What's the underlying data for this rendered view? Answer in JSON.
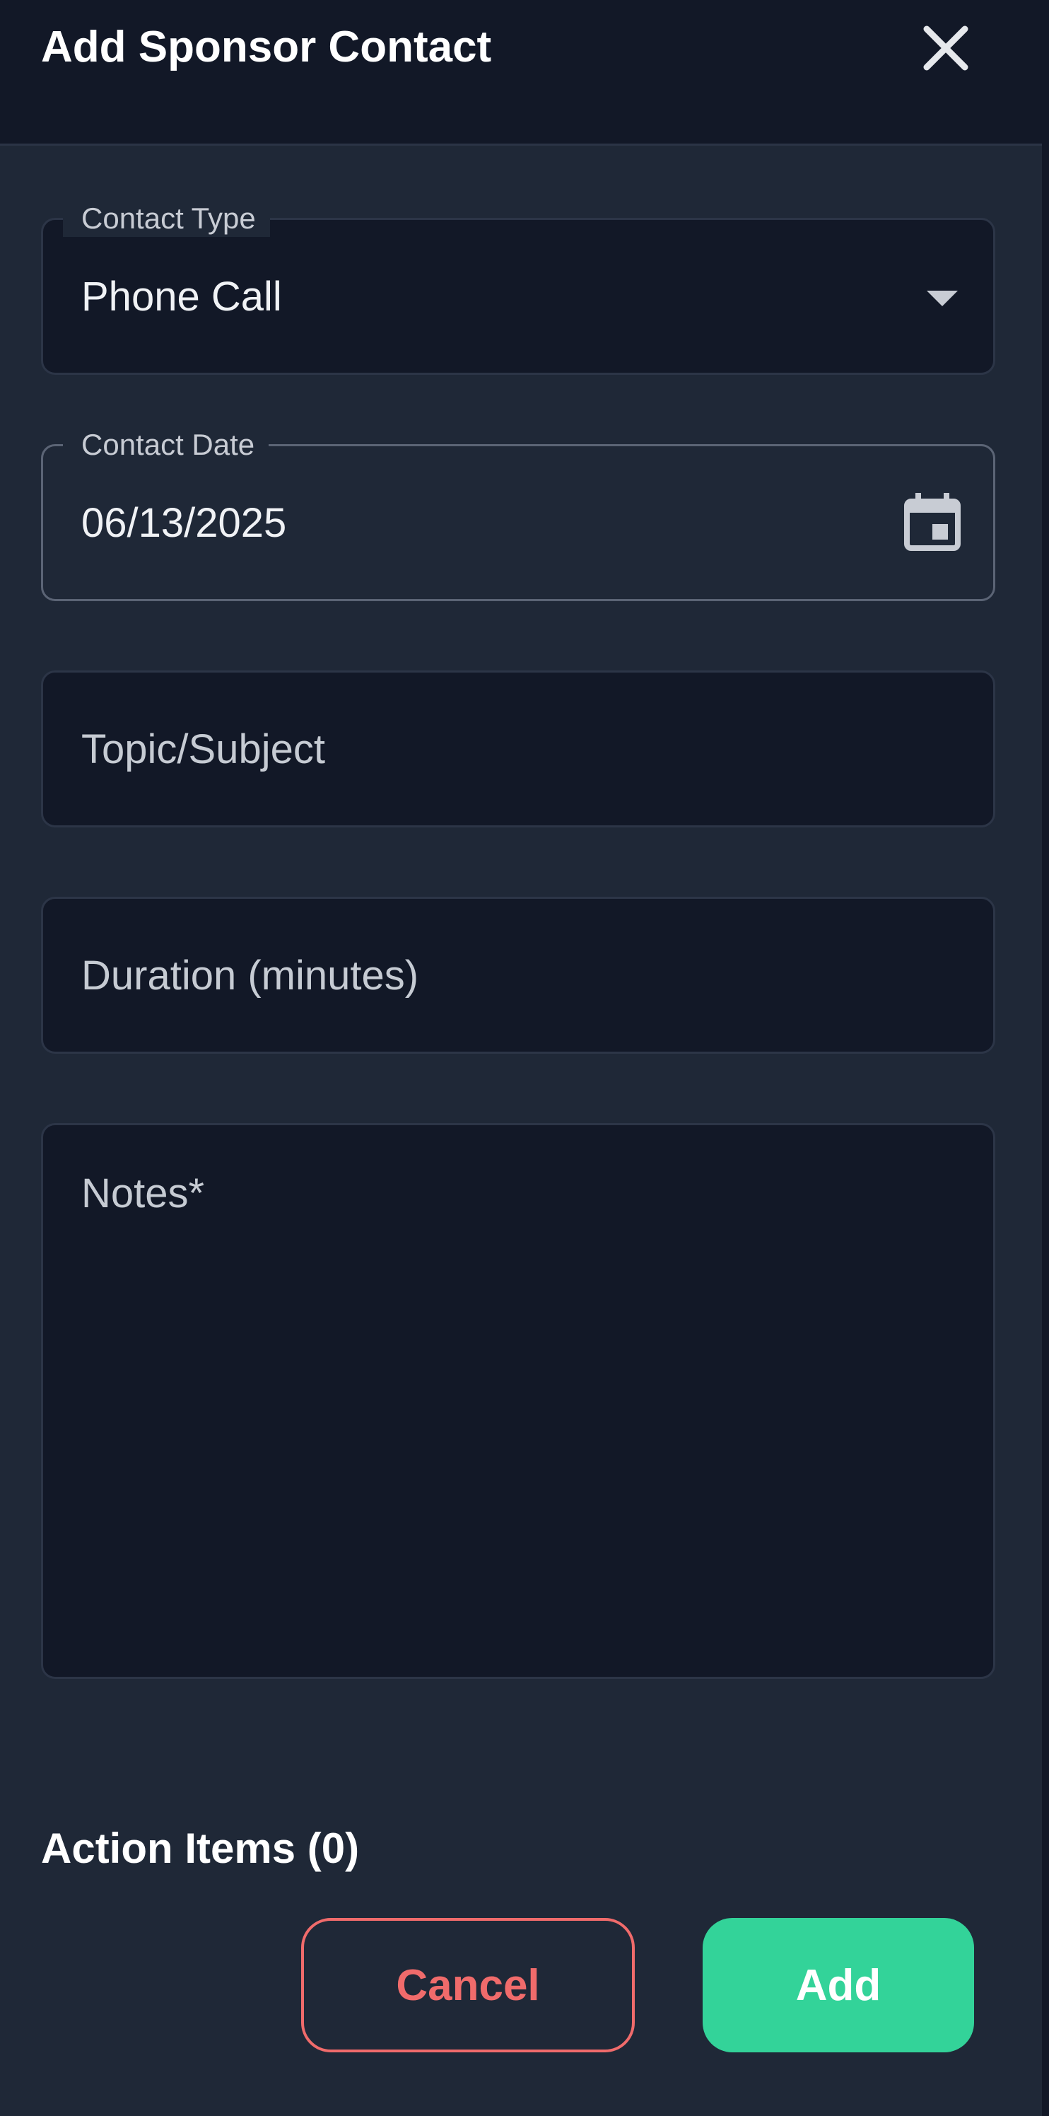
{
  "dialog": {
    "title": "Add Sponsor Contact",
    "close_icon": "close-icon"
  },
  "form": {
    "contact_type": {
      "label": "Contact Type",
      "value": "Phone Call",
      "icon": "dropdown-arrow-icon"
    },
    "contact_date": {
      "label": "Contact Date",
      "value": "06/13/2025",
      "icon": "calendar-icon"
    },
    "topic": {
      "placeholder": "Topic/Subject"
    },
    "duration": {
      "placeholder": "Duration (minutes)"
    },
    "notes": {
      "placeholder": "Notes*"
    }
  },
  "action_items": {
    "heading": "Action Items (0)"
  },
  "buttons": {
    "cancel_label": "Cancel",
    "add_label": "Add"
  },
  "colors": {
    "background": "#1f2837",
    "header": "#121827",
    "field": "#121827",
    "cancel": "#f06b6b",
    "add": "#33d399"
  }
}
